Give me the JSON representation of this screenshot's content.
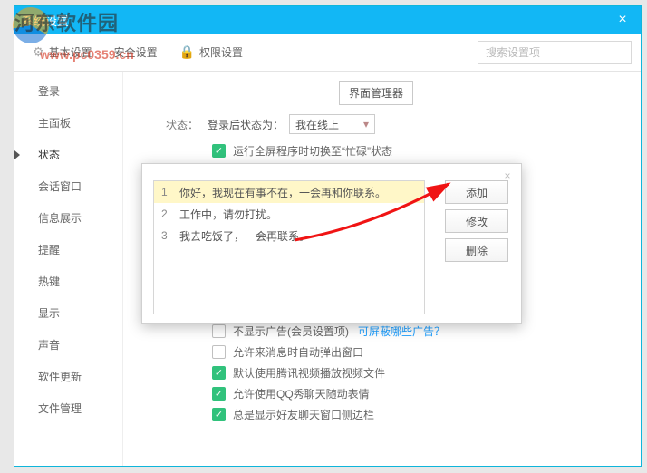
{
  "window": {
    "title": "系统设置",
    "close_glyph": "×"
  },
  "watermark": {
    "main": "河东软件园",
    "url": "www.pc0359.cn"
  },
  "topbar": {
    "basic": "基本设置",
    "security": "安全设置",
    "perm": "权限设置",
    "perm_glyph": "🔒"
  },
  "search": {
    "placeholder": "搜索设置项"
  },
  "sidebar": {
    "items": [
      {
        "label": "登录",
        "key": "login"
      },
      {
        "label": "主面板",
        "key": "mainpanel"
      },
      {
        "label": "状态",
        "key": "status",
        "active": true
      },
      {
        "label": "会话窗口",
        "key": "session"
      },
      {
        "label": "信息展示",
        "key": "info"
      },
      {
        "label": "提醒",
        "key": "remind"
      },
      {
        "label": "热键",
        "key": "hotkey"
      },
      {
        "label": "显示",
        "key": "display"
      },
      {
        "label": "声音",
        "key": "sound"
      },
      {
        "label": "软件更新",
        "key": "update"
      },
      {
        "label": "文件管理",
        "key": "files"
      }
    ]
  },
  "main": {
    "ui_manager": "界面管理器",
    "status_label": "状态：",
    "login_status_label": "登录后状态为：",
    "login_status_value": "我在线上",
    "fullscreen_busy": "运行全屏程序时切换至“忙碌”状态",
    "no_ads": "不显示广告(会员设置项)",
    "no_ads_link": "可屏蔽哪些广告？",
    "popup_on_msg": "允许来消息时自动弹出窗口",
    "use_tencent_video": "默认使用腾讯视频播放视频文件",
    "qq_show_emoji": "允许使用QQ秀聊天随动表情",
    "always_sidebar": "总是显示好友聊天窗口侧边栏"
  },
  "modal": {
    "close_glyph": "×",
    "items": [
      "你好，我现在有事不在，一会再和你联系。",
      "工作中，请勿打扰。",
      "我去吃饭了，一会再联系。"
    ],
    "add": "添加",
    "modify": "修改",
    "delete": "删除"
  }
}
